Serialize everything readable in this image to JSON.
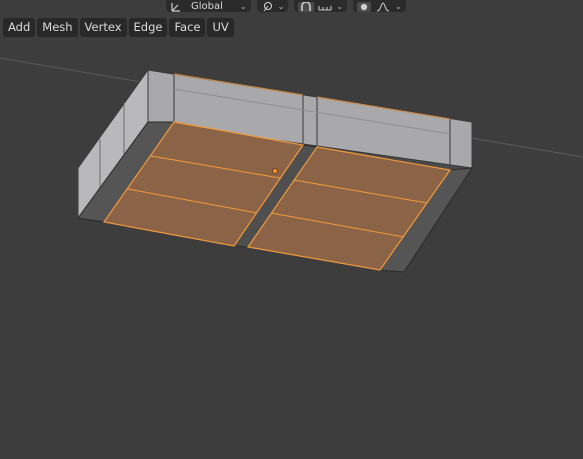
{
  "header": {
    "transform_orientation": "Global",
    "icons": [
      "transform-orientation-icon",
      "pivot-point-icon",
      "snap-icon",
      "snap-increment-icon",
      "proportional-editing-icon",
      "falloff-icon"
    ]
  },
  "menu": {
    "items": [
      "Add",
      "Mesh",
      "Vertex",
      "Edge",
      "Face",
      "UV"
    ]
  },
  "colors": {
    "viewport_bg": "#3d3d3d",
    "selected_face": "#8a6446",
    "selected_edge": "#f59a3a",
    "wall_face": "#a8a8aa",
    "floor_face": "#545454",
    "active_vertex": "#ff8c1a"
  },
  "scene": {
    "mode": "edit-mode",
    "selection": "faces"
  }
}
